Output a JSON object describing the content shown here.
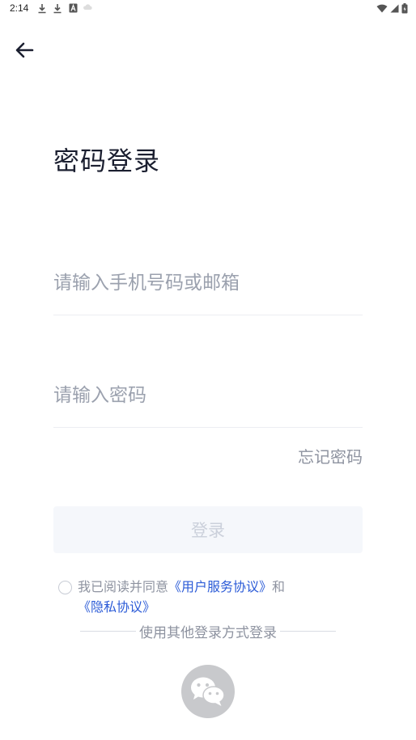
{
  "status_bar": {
    "time": "2:14",
    "left_icons": [
      "download-icon",
      "download-icon",
      "font-icon",
      "cloud-icon"
    ],
    "right_icons": [
      "wifi-icon",
      "signal-icon",
      "battery-icon"
    ]
  },
  "page": {
    "title": "密码登录"
  },
  "form": {
    "phone_placeholder": "请输入手机号码或邮箱",
    "phone_value": "",
    "password_placeholder": "请输入密码",
    "password_value": "",
    "forgot_label": "忘记密码",
    "login_label": "登录"
  },
  "agreement": {
    "prefix": "我已阅读并同意",
    "service_link": "《用户服务协议》",
    "conjunction": "和",
    "privacy_link": "《隐私协议》",
    "checked": false
  },
  "other_login": {
    "label": "使用其他登录方式登录",
    "options": [
      "wechat-icon"
    ]
  },
  "colors": {
    "link": "#2b5bd7",
    "muted_text": "#8e93a0",
    "disabled_button_bg": "#f5f7fb",
    "disabled_button_text": "#cbd0db",
    "wechat_button_bg": "#c8c9cc"
  }
}
